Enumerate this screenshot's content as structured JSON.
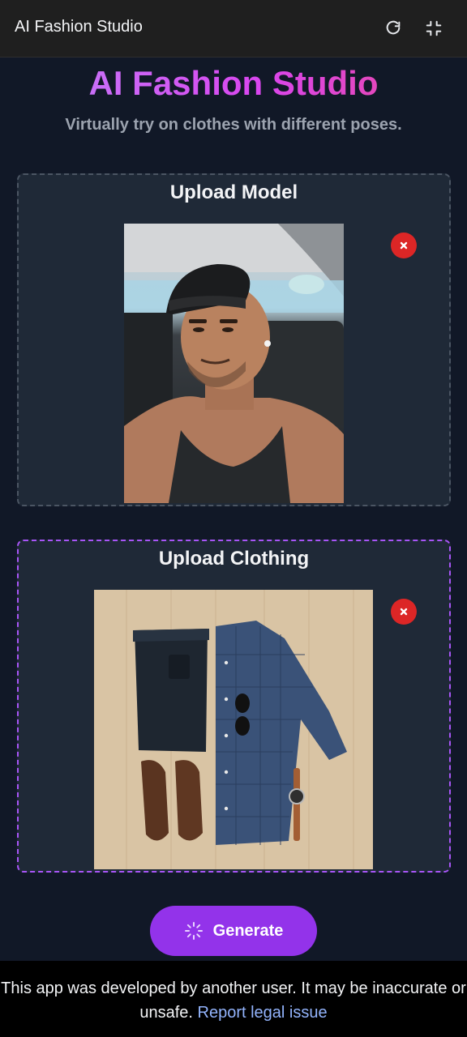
{
  "topbar": {
    "title": "AI Fashion Studio",
    "refresh_icon": "refresh-icon",
    "collapse_icon": "collapse-icon"
  },
  "hero": {
    "title": "AI Fashion Studio",
    "subtitle": "Virtually try on clothes with different poses."
  },
  "model_card": {
    "title": "Upload Model",
    "remove_icon": "close-icon"
  },
  "clothing_card": {
    "title": "Upload Clothing",
    "remove_icon": "close-icon"
  },
  "generate_button": {
    "label": "Generate",
    "icon": "sparkle-icon"
  },
  "footer": {
    "notice": "This app was developed by another user. It may be inaccurate or unsafe.",
    "link": "Report legal issue"
  },
  "colors": {
    "background": "#111827",
    "card": "#1f2937",
    "accent": "#9333ea",
    "remove": "#dc2626",
    "link": "#93b4fd"
  }
}
